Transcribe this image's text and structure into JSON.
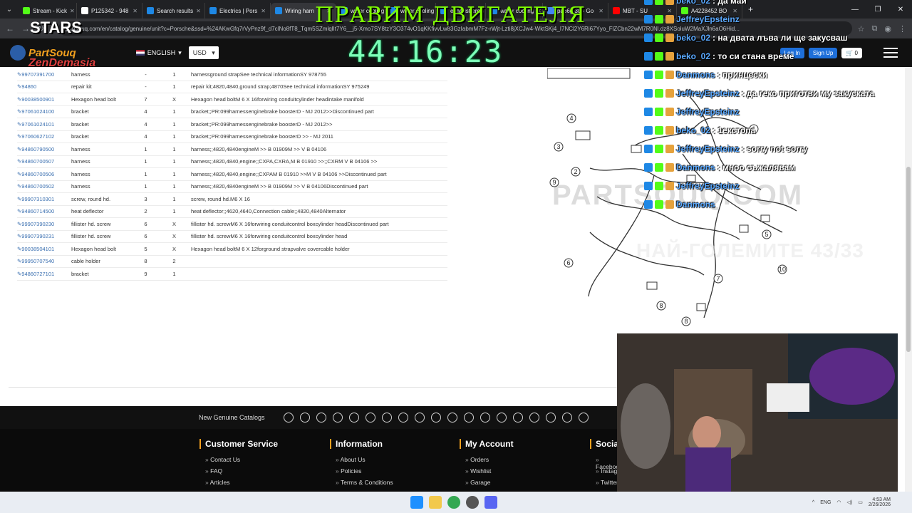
{
  "browser": {
    "tabs": [
      {
        "label": "Stream - Kick",
        "color": "#53fc18",
        "active": false
      },
      {
        "label": "P125342 - 948",
        "color": "#ffffff",
        "active": false
      },
      {
        "label": "Search results",
        "color": "#1e88e5",
        "active": false
      },
      {
        "label": "Electrics | Pors",
        "color": "#1e88e5",
        "active": false
      },
      {
        "label": "Wiring harn",
        "color": "#1e88e5",
        "active": true
      },
      {
        "label": "water cooling",
        "color": "#1e88e5",
        "active": false
      },
      {
        "label": "water cooling",
        "color": "#1e88e5",
        "active": false
      },
      {
        "label": "exhaust emis",
        "color": "#1e88e5",
        "active": false
      },
      {
        "label": "water cooling",
        "color": "#1e88e5",
        "active": false
      },
      {
        "label": "pa66gf30 - Go",
        "color": "#4285f4",
        "active": false
      },
      {
        "label": "MBT - SU",
        "color": "#ff0000",
        "active": false
      },
      {
        "label": "A4228452 BO",
        "color": "#53fc18",
        "active": false
      }
    ],
    "new_tab": "+",
    "url": "partsouq.com/en/catalog/genuine/unit?c=Porsche&ssd=%24AKwGfq7rVyPnz9f_d7clNo8fT8_Tqm5SZmlqlIt7Y6__j5-Xmo7SY8tzY3O374vO1qKKfivvLw83GzIabmM7Fz-rWjt-Lzti8jXCJw4-WktSKj4_I7NCl2Y6Ri67Yyo_FlZCbn22wM7R0Nl.dz8XSoluW2MaXJln6aO6Hid..."
  },
  "site": {
    "logo": "PartSouq",
    "language": "ENGLISH",
    "currency": "USD",
    "login": "Log In",
    "signup": "Sign Up",
    "cart_count": "0"
  },
  "parts": [
    {
      "pn": "99707391700",
      "name": "harness",
      "pos": "-",
      "qty": "1",
      "remark": "harnessground strapSee technical informationSY 978755"
    },
    {
      "pn": "94860",
      "name": "repair kit",
      "pos": "-",
      "qty": "1",
      "remark": "repair kit;4820,4840,ground strap;4870See technical informationSY 975249"
    },
    {
      "pn": "90038500901",
      "name": "Hexagon head bolt",
      "pos": "7",
      "qty": "X",
      "remark": "Hexagon head boltM 6 X 16forwiring conduitcylinder headintake manifold"
    },
    {
      "pn": "97061024100",
      "name": "bracket",
      "pos": "4",
      "qty": "1",
      "remark": "bracket;;PR:099harnessenginebrake boosterD - MJ 2012>>Discontinued part"
    },
    {
      "pn": "97061024101",
      "name": "bracket",
      "pos": "4",
      "qty": "1",
      "remark": "bracket;;PR:099harnessenginebrake boosterD - MJ 2012>>"
    },
    {
      "pn": "97060627102",
      "name": "bracket",
      "pos": "4",
      "qty": "1",
      "remark": "bracket;;PR:099harnessenginebrake boosterD >> - MJ 2011"
    },
    {
      "pn": "94860790500",
      "name": "harness",
      "pos": "1",
      "qty": "1",
      "remark": "harness;;4820,4840engineM >> B 01909M >> V B 04106"
    },
    {
      "pn": "94860700507",
      "name": "harness",
      "pos": "1",
      "qty": "1",
      "remark": "harness;;4820,4840,engine;;CXPA,CXRA,M B 01910 >>;;CXRM V B 04106 >>"
    },
    {
      "pn": "94860700506",
      "name": "harness",
      "pos": "1",
      "qty": "1",
      "remark": "harness;;4820,4840,engine;;CXPAM B 01910 >>M V B 04106 >>Discontinued part"
    },
    {
      "pn": "94860700502",
      "name": "harness",
      "pos": "1",
      "qty": "1",
      "remark": "harness;;4820,4840engineM >> B 01909M >> V B 04106Discontinued part"
    },
    {
      "pn": "99907310301",
      "name": "screw, round hd.",
      "pos": "3",
      "qty": "1",
      "remark": "screw, round hd.M6 X 16"
    },
    {
      "pn": "94860714500",
      "name": "heat deflector",
      "pos": "2",
      "qty": "1",
      "remark": "heat deflector;;4620,4640,Connection cable;;4820,4840Alternator"
    },
    {
      "pn": "99907390230",
      "name": "fillister hd. screw",
      "pos": "6",
      "qty": "X",
      "remark": "fillister hd. screwM6 X 16forwiring conduitcontrol boxcylinder headDiscontinued part"
    },
    {
      "pn": "99907390231",
      "name": "fillister hd. screw",
      "pos": "6",
      "qty": "X",
      "remark": "fillister hd. screwM6 X 16forwiring conduitcontrol boxcylinder head"
    },
    {
      "pn": "90038504101",
      "name": "Hexagon head bolt",
      "pos": "5",
      "qty": "X",
      "remark": "Hexagon head boltM 6 X 12forground strapvalve covercable holder"
    },
    {
      "pn": "99950707540",
      "name": "cable holder",
      "pos": "8",
      "qty": "2",
      "remark": ""
    },
    {
      "pn": "94860727101",
      "name": "bracket",
      "pos": "9",
      "qty": "1",
      "remark": ""
    }
  ],
  "diagram": {
    "watermark": "PARTSOUQ.COM",
    "callouts": [
      "4",
      "3",
      "2",
      "1",
      "5",
      "6",
      "7",
      "8",
      "8",
      "9",
      "10"
    ]
  },
  "catalog_bar": {
    "title": "New Genuine Catalogs"
  },
  "footer": {
    "customer_service": {
      "title": "Customer Service",
      "links": [
        "Contact Us",
        "FAQ",
        "Articles"
      ]
    },
    "information": {
      "title": "Information",
      "links": [
        "About Us",
        "Policies",
        "Terms & Conditions"
      ]
    },
    "my_account": {
      "title": "My Account",
      "links": [
        "Orders",
        "Wishlist",
        "Garage"
      ]
    },
    "social": {
      "title": "Socia",
      "links": [
        "Faceboo",
        "Instag",
        "Twitter"
      ]
    }
  },
  "stream": {
    "title": "ПРАВИМ ДВИГАТЕЛЯ",
    "timer": "44:16:23",
    "overlay": "НАЙ-ГОЛЕМИТЕ 43/33",
    "brand_top": "STARS",
    "brand_bottom": "ZenDemasia",
    "chat": [
      {
        "user": "beko_02",
        "text": ": да май"
      },
      {
        "user": "JeffreyEpsteinz",
        "text": ""
      },
      {
        "user": "beko_02",
        "text": ": на двата лъва ли ще закусваш"
      },
      {
        "user": "beko_02",
        "text": ": то си стана време"
      },
      {
        "user": "Danmons",
        "text": ": принцески"
      },
      {
        "user": "JeffreyEpsteinz",
        "text": ": да геко приготви му закуската"
      },
      {
        "user": "JeffreyEpsteinz",
        "text": ""
      },
      {
        "user": "beko_02",
        "text": ": 1екстопа"
      },
      {
        "user": "JeffreyEpsteinz",
        "text": ": sorry not sorry"
      },
      {
        "user": "Danmons",
        "text": ": мноо съжалявам"
      },
      {
        "user": "JeffreyEpsteinz",
        "text": ""
      },
      {
        "user": "Danmons",
        "text": ""
      }
    ]
  },
  "taskbar": {
    "lang": "ENG",
    "time": "4:53 AM",
    "date": "2/26/2026"
  }
}
